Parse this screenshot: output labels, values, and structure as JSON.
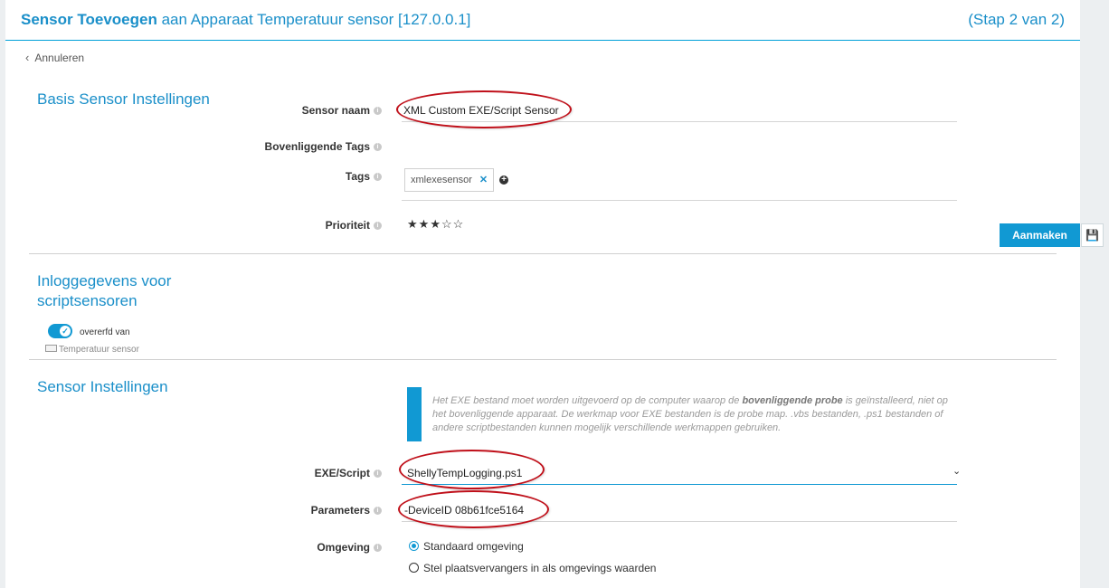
{
  "header": {
    "title_bold": "Sensor Toevoegen",
    "title_rest": " aan Apparaat Temperatuur sensor [127.0.0.1]",
    "step": "(Stap 2 van 2)"
  },
  "cancel_label": "Annuleren",
  "basic": {
    "section_title": "Basis Sensor Instellingen",
    "sensor_name_label": "Sensor naam",
    "sensor_name_value": "XML Custom EXE/Script Sensor",
    "parent_tags_label": "Bovenliggende Tags",
    "tags_label": "Tags",
    "tags": [
      "xmlexesensor"
    ],
    "priority_label": "Prioriteit",
    "priority": 3,
    "priority_max": 5
  },
  "actions": {
    "create_label": "Aanmaken",
    "save_icon": "floppy-disk-icon"
  },
  "credentials": {
    "section_title_line1": "Inloggegevens voor",
    "section_title_line2": "scriptsensoren",
    "inherit_label": "overerfd van",
    "inherit_source": "Temperatuur sensor",
    "inherit_enabled": true
  },
  "sensor_settings": {
    "section_title": "Sensor Instellingen",
    "note_part1": "Het EXE bestand moet worden uitgevoerd op de computer waarop de ",
    "note_bold": "bovenliggende probe",
    "note_part2": " is geïnstalleerd, niet op het bovenliggende apparaat. De werkmap voor EXE bestanden is de probe map. .vbs bestanden, .ps1 bestanden of andere scriptbestanden kunnen mogelijk verschillende werkmappen gebruiken.",
    "exe_label": "EXE/Script",
    "exe_value": "ShellyTempLogging.ps1",
    "params_label": "Parameters",
    "params_value": "-DeviceID 08b61fce5164",
    "env_label": "Omgeving",
    "env_options": [
      "Standaard omgeving",
      "Stel plaatsvervangers in als omgevings waarden"
    ],
    "env_selected": 0
  },
  "colors": {
    "accent": "#1199d3",
    "annotation": "#c0101a"
  }
}
